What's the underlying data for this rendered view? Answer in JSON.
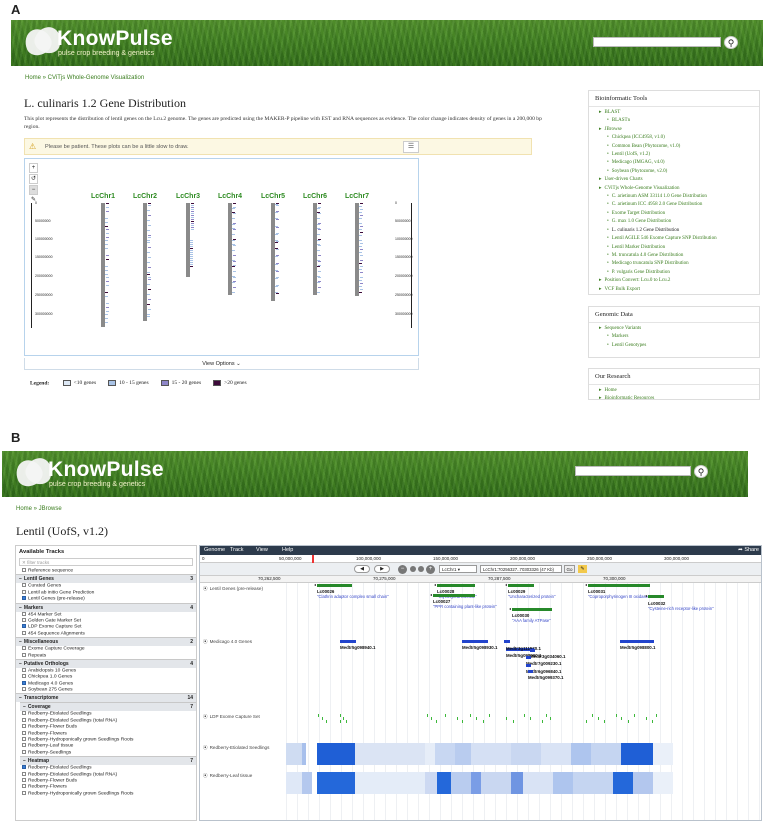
{
  "panel_a": {
    "label": "A",
    "site": {
      "title": "KnowPulse",
      "subtitle": "pulse crop breeding & genetics"
    },
    "breadcrumb": "Home » CViTjs Whole-Genome Visualization",
    "page_title": "L. culinaris 1.2 Gene Distribution",
    "description": "This plot represents the distribution of lentil genes on the Lcu.2 genome. The genes are predicted using the MAKER-P pipeline with EST and RNA sequences as evidence. The color change indicates density of genes in a 200,000 bp region.",
    "warning": "Please be patient. These plots can be a little slow to draw.",
    "view_options": "View Options",
    "chromosomes": [
      "LcChr1",
      "LcChr2",
      "LcChr3",
      "LcChr4",
      "LcChr5",
      "LcChr6",
      "LcChr7"
    ],
    "axis_ticks": [
      "0",
      "50000000",
      "100000000",
      "150000000",
      "200000000",
      "250000000",
      "300000000"
    ],
    "legend": {
      "title": "Legend:",
      "items": [
        {
          "label": "<10 genes",
          "color": "#dde8f5"
        },
        {
          "label": "10 - 15 genes",
          "color": "#a9c3e6"
        },
        {
          "label": "15 - 20 genes",
          "color": "#8e86c8"
        },
        {
          "label": ">20 genes",
          "color": "#3d0b3a"
        }
      ]
    },
    "sidebar": {
      "tools_title": "Bioinformatic Tools",
      "tools": [
        {
          "t": "BLAST",
          "lvl": 1
        },
        {
          "t": "BLASTn",
          "lvl": 2
        },
        {
          "t": "JBrowse",
          "lvl": 1
        },
        {
          "t": "Chickpea (ICC4958, v1.0)",
          "lvl": 2
        },
        {
          "t": "Common Bean (Phytozome, v1.0)",
          "lvl": 2
        },
        {
          "t": "Lentil (UofS, v1.2)",
          "lvl": 2
        },
        {
          "t": "Medicago (IMGAG, v4.0)",
          "lvl": 2
        },
        {
          "t": "Soybean (Phytozome, v2.0)",
          "lvl": 2
        },
        {
          "t": "User-driven Charts",
          "lvl": 1
        },
        {
          "t": "CViTjs Whole-Genome Visualization",
          "lvl": 1
        },
        {
          "t": "C. arietinum ASM 33114 1.0 Gene Distribution",
          "lvl": 2
        },
        {
          "t": "C. arietinum ICC 4958 2.0 Gene Distribution",
          "lvl": 2
        },
        {
          "t": "Exome Target Distribution",
          "lvl": 2
        },
        {
          "t": "G. max 1.0 Gene Distribution",
          "lvl": 2
        },
        {
          "t": "L. culinaris 1.2 Gene Distribution",
          "lvl": 2,
          "active": true
        },
        {
          "t": "Lentil AGILE 546 Exome Capture SNP Distribution",
          "lvl": 2
        },
        {
          "t": "Lentil Marker Distribution",
          "lvl": 2
        },
        {
          "t": "M. truncatula 4.0 Gene Distribution",
          "lvl": 2
        },
        {
          "t": "Medicago truncatula SNP Distribution",
          "lvl": 2
        },
        {
          "t": "P. vulgaris Gene Distribution",
          "lvl": 2
        },
        {
          "t": "Position Convert: Lcu.0 to Lcu.2",
          "lvl": 1
        },
        {
          "t": "VCF Bulk Export",
          "lvl": 1
        }
      ],
      "genomic_title": "Genomic Data",
      "genomic": [
        {
          "t": "Sequence Variants",
          "lvl": 1
        },
        {
          "t": "Markers",
          "lvl": 2
        },
        {
          "t": "Lentil Genotypes",
          "lvl": 2
        }
      ],
      "research_title": "Our Research",
      "research": [
        {
          "t": "Home",
          "lvl": 1
        },
        {
          "t": "Bioinformatic Resources",
          "lvl": 1
        }
      ]
    }
  },
  "panel_b": {
    "label": "B",
    "breadcrumb": "Home » JBrowse",
    "page_title": "Lentil (UofS, v1.2)",
    "menu": [
      "Genome",
      "Track",
      "View",
      "Help"
    ],
    "share": "Share",
    "ruler": [
      "0",
      "50,000,000",
      "100,000,000",
      "150,000,000",
      "200,000,000",
      "250,000,000",
      "300,000,000"
    ],
    "location": "LcChr1:70256327..70303326 (47 Kb)",
    "location_short": "LcChr1",
    "go": "Go",
    "detail_ruler": [
      "70,262,500",
      "70,275,000",
      "70,287,500",
      "70,300,000"
    ],
    "available_tracks": "Available Tracks",
    "filter_placeholder": "filter tracks",
    "reference": "Reference sequence",
    "track_groups": [
      {
        "name": "Lentil Genes",
        "count": "3",
        "items": [
          {
            "t": "Curated Genes",
            "on": false
          },
          {
            "t": "Lentil ab initio Gene Prediction",
            "on": false
          },
          {
            "t": "Lentil Genes (pre-release)",
            "on": true
          }
        ]
      },
      {
        "name": "Markers",
        "count": "4",
        "items": [
          {
            "t": "454 Marker Set",
            "on": false
          },
          {
            "t": "Golden Gate Marker Set",
            "on": false
          },
          {
            "t": "LDP Exome Capture Set",
            "on": true
          },
          {
            "t": "454 Sequence Alignments",
            "on": false
          }
        ]
      },
      {
        "name": "Miscellaneous",
        "count": "2",
        "items": [
          {
            "t": "Exome Capture Coverage",
            "on": false
          },
          {
            "t": "Repeats",
            "on": false
          }
        ]
      },
      {
        "name": "Putative Orthologs",
        "count": "4",
        "items": [
          {
            "t": "Arabidopsis 10 Genes",
            "on": false
          },
          {
            "t": "Chickpea 1.0 Genes",
            "on": false
          },
          {
            "t": "Medicago 4.0 Genes",
            "on": true
          },
          {
            "t": "Soybean 275 Genes",
            "on": false
          }
        ]
      },
      {
        "name": "Transcriptome",
        "count": "14",
        "items": []
      },
      {
        "name": "Coverage",
        "count": "7",
        "sub": true,
        "items": [
          {
            "t": "Redberry-Etiolated Seedlings",
            "on": false
          },
          {
            "t": "Redberry-Etiolated Seedlings (total RNA)",
            "on": false
          },
          {
            "t": "Redberry-Flower Buds",
            "on": false
          },
          {
            "t": "Redberry-Flowers",
            "on": false
          },
          {
            "t": "Redberry-Hydroponically grown Seedlings Roots",
            "on": false
          },
          {
            "t": "Redberry-Leaf tissue",
            "on": false
          },
          {
            "t": "Redberry-Seedlings",
            "on": false
          }
        ]
      },
      {
        "name": "Heatmap",
        "count": "7",
        "sub": true,
        "items": [
          {
            "t": "Redberry-Etiolated Seedlings",
            "on": true
          },
          {
            "t": "Redberry-Etiolated Seedlings (total RNA)",
            "on": false
          },
          {
            "t": "Redberry-Flower Buds",
            "on": false
          },
          {
            "t": "Redberry-Flowers",
            "on": false
          },
          {
            "t": "Redberry-Hydroponically grown Seedlings Roots",
            "on": false
          }
        ]
      }
    ],
    "track_labels": [
      "Lentil Genes (pre-release)",
      "Medicago 4.0 Genes",
      "LDP Exome Capture Set",
      "Redberry-Etiolated Seedlings",
      "Redberry-Leaf tissue"
    ],
    "lentil_genes": [
      {
        "id": "Lc00026",
        "desc": "\"Clathrin adaptor complex small chain\""
      },
      {
        "id": "Lc00028",
        "desc": "\"Glycosyltransferase\""
      },
      {
        "id": "Lc00029",
        "desc": "\"Uncharacterized protein\""
      },
      {
        "id": "Lc00031",
        "desc": "\"Coproporphyrinogen III oxidase\""
      },
      {
        "id": "Lc00027",
        "desc": "\"PPR containing plant-like protein\""
      },
      {
        "id": "Lc00030",
        "desc": "\"AAA family ATPase\""
      },
      {
        "id": "Lc00032",
        "desc": "\"Cysteine-rich receptor-like protein\""
      }
    ],
    "medicago_genes": [
      "Medtr5g098940.1",
      "Medtr5g098930.1",
      "Medtr5g098960.1",
      "Medtr3g111520.1",
      "Medtr3g034060.1",
      "Medtr7g009230.1",
      "Medtr6g096840.1",
      "Medtr5g099370.1",
      "Medtr5g098800.1"
    ]
  }
}
